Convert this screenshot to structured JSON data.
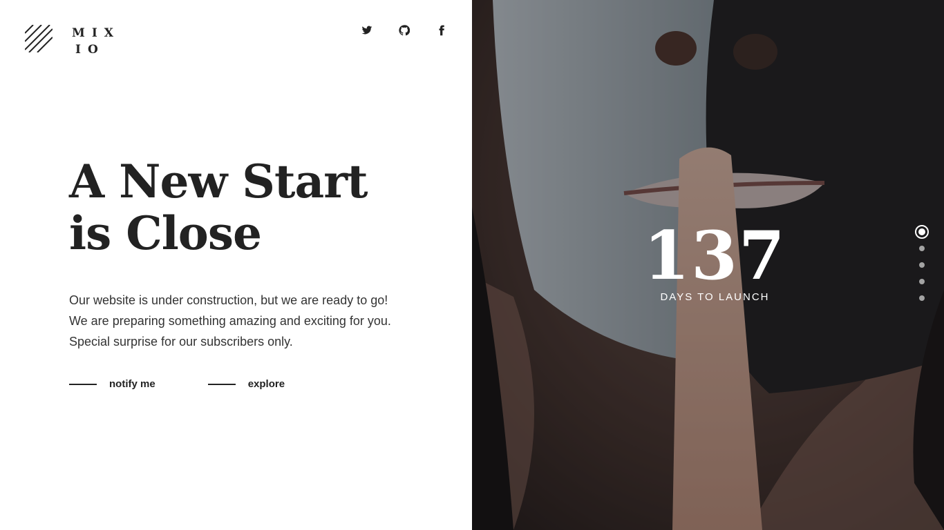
{
  "brand": {
    "line1": "MIX",
    "line2": "IO"
  },
  "social": [
    {
      "icon": "twitter-icon"
    },
    {
      "icon": "github-icon"
    },
    {
      "icon": "facebook-icon"
    }
  ],
  "hero": {
    "title_line1": "A New Start",
    "title_line2": "is Close",
    "description": "Our website is under construction, but we are ready to go! We are preparing something amazing and exciting for you. Special surprise for our subscribers only."
  },
  "actions": [
    {
      "label": "notify me"
    },
    {
      "label": "explore"
    }
  ],
  "countdown": {
    "value": "137",
    "label": "DAYS TO LAUNCH"
  },
  "pager": {
    "count": 5,
    "active_index": 0
  },
  "colors": {
    "text": "#222222",
    "overlay": "#141416",
    "white": "#ffffff"
  }
}
